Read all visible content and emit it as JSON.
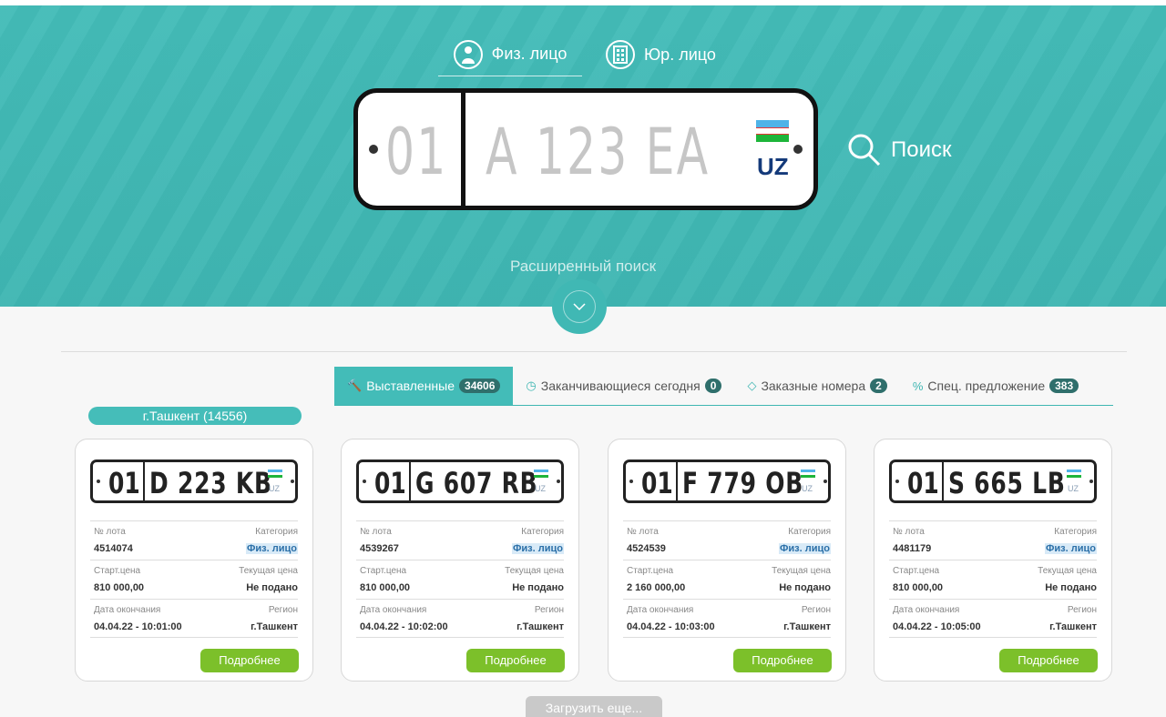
{
  "person_tabs": [
    {
      "label": "Физ. лицо",
      "icon": "person-icon",
      "active": true
    },
    {
      "label": "Юр. лицо",
      "icon": "building-icon",
      "active": false
    }
  ],
  "plate_input": {
    "region": "01",
    "number": "A 123 EA",
    "country": "UZ"
  },
  "search_label": "Поиск",
  "advanced_search": "Расширенный поиск",
  "tabs": [
    {
      "label": "Выставленные",
      "count": "34606",
      "icon": "gavel-icon",
      "active": true
    },
    {
      "label": "Заканчивающиеся сегодня",
      "count": "0",
      "icon": "clock-icon",
      "active": false
    },
    {
      "label": "Заказные номера",
      "count": "2",
      "icon": "diamond-icon",
      "active": false
    },
    {
      "label": "Спец. предложение",
      "count": "383",
      "icon": "percent-icon",
      "active": false
    }
  ],
  "region_filter": "г.Ташкент (14556)",
  "labels": {
    "lot_no": "№ лота",
    "category": "Категория",
    "start_price": "Старт.цена",
    "current_price": "Текущая цена",
    "end_date": "Дата окончания",
    "region": "Регион",
    "details_button": "Подробнее"
  },
  "lots": [
    {
      "plate_region": "01",
      "plate_number": "D 223 KB",
      "country": "UZ",
      "lot": "4514074",
      "category": "Физ. лицо",
      "start_price": "810 000,00",
      "current_price": "Не подано",
      "end_date": "04.04.22 - 10:01:00",
      "region": "г.Ташкент"
    },
    {
      "plate_region": "01",
      "plate_number": "G 607 RB",
      "country": "UZ",
      "lot": "4539267",
      "category": "Физ. лицо",
      "start_price": "810 000,00",
      "current_price": "Не подано",
      "end_date": "04.04.22 - 10:02:00",
      "region": "г.Ташкент"
    },
    {
      "plate_region": "01",
      "plate_number": "F 779 OB",
      "country": "UZ",
      "lot": "4524539",
      "category": "Физ. лицо",
      "start_price": "2 160 000,00",
      "current_price": "Не подано",
      "end_date": "04.04.22 - 10:03:00",
      "region": "г.Ташкент"
    },
    {
      "plate_region": "01",
      "plate_number": "S 665 LB",
      "country": "UZ",
      "lot": "4481179",
      "category": "Физ. лицо",
      "start_price": "810 000,00",
      "current_price": "Не подано",
      "end_date": "04.04.22 - 10:05:00",
      "region": "г.Ташкент"
    }
  ],
  "load_more": "Загрузить еще...",
  "colors": {
    "teal": "#43bcb8",
    "green_button": "#7cc02a",
    "badge": "#2f6f6c",
    "flag_blue": "#4fb3e8",
    "flag_green": "#1eb53a"
  }
}
